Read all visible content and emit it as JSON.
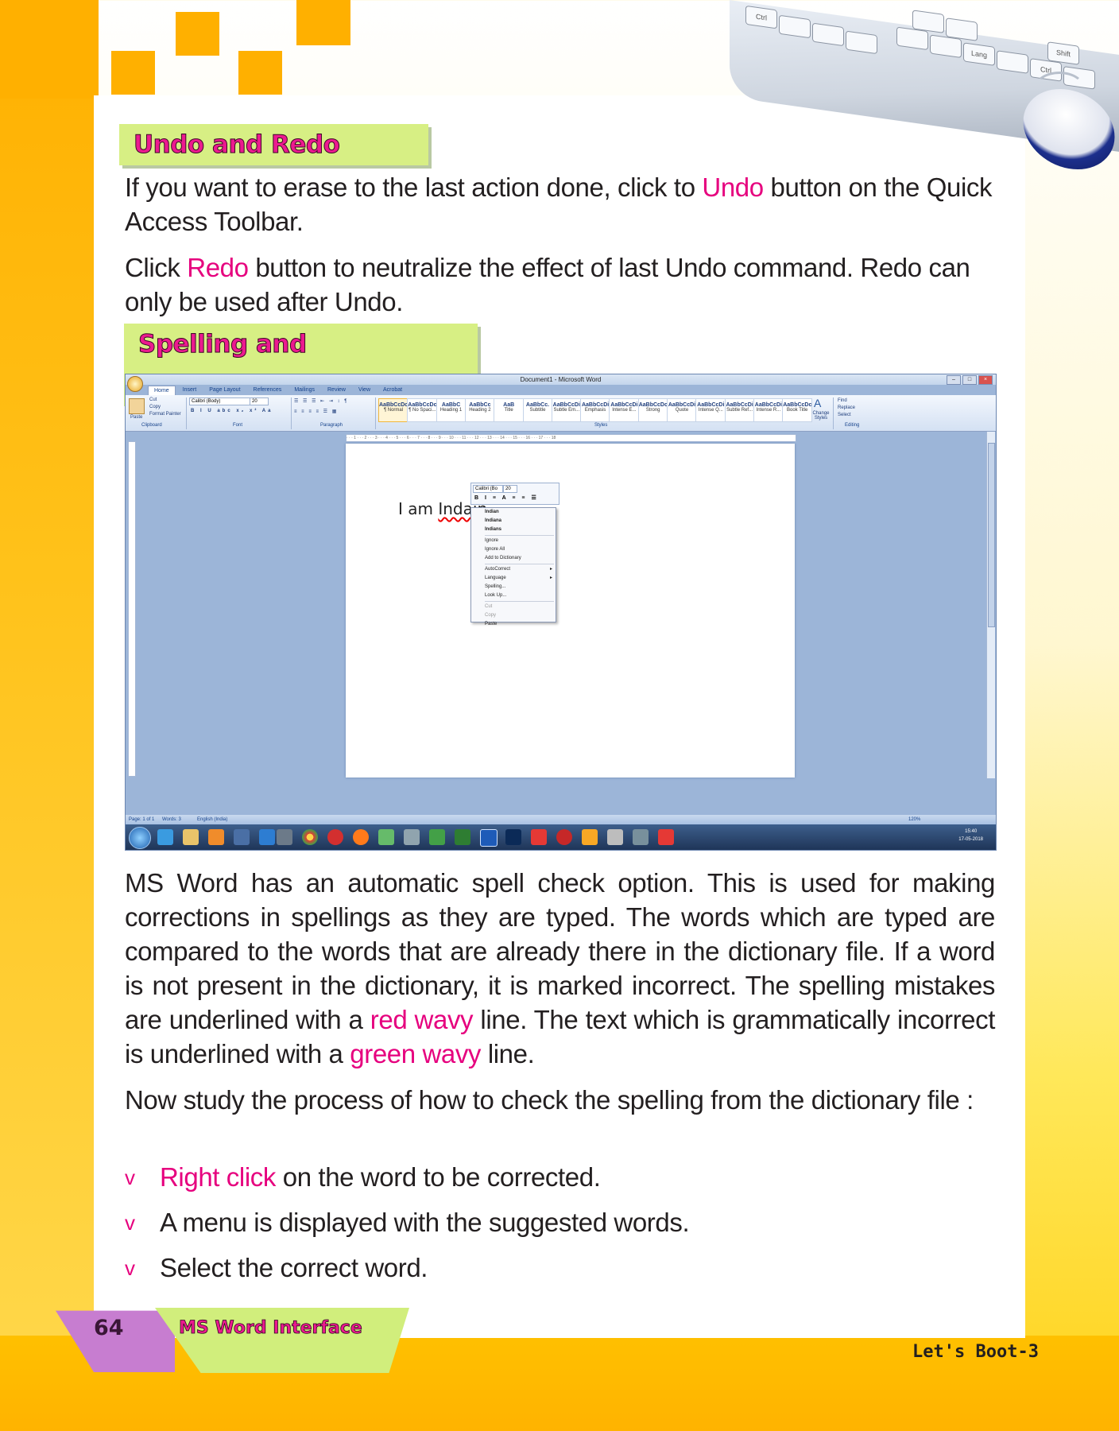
{
  "sections": {
    "undo_redo": {
      "heading": "Undo and Redo",
      "para1_a": "If you want to erase to the last action done, click to ",
      "para1_hl": "Undo",
      "para1_b": " button on the Quick Access Toolbar.",
      "para2_a": "Click ",
      "para2_hl": "Redo",
      "para2_b": " button to neutralize the effect of last Undo command. Redo can only be used after Undo."
    },
    "spelling": {
      "heading": "Spelling and Autocorrect",
      "para1_a": "MS Word has an automatic spell check option. This is used for making corrections in spellings as they are typed. The words which are typed are compared to the words that are already there in the dictionary file. If a word is not present in the dictionary, it is marked incorrect. The spelling mistakes are underlined with a ",
      "para1_hl1": "red wavy",
      "para1_b": " line. The text which is grammatically incorrect is underlined with a ",
      "para1_hl2": "green wavy",
      "para1_c": " line.",
      "para2": "Now study the process of how to check the spelling from the dictionary file :",
      "bullet_marker": "v",
      "bullets": [
        {
          "hl": "Right click",
          "text": " on the word to be corrected."
        },
        {
          "hl": "",
          "text": "A menu is displayed with the suggested words."
        },
        {
          "hl": "",
          "text": "Select the correct word."
        }
      ]
    }
  },
  "screenshot": {
    "title": "Document1 - Microsoft Word",
    "tabs": [
      "Home",
      "Insert",
      "Page Layout",
      "References",
      "Mailings",
      "Review",
      "View",
      "Acrobat"
    ],
    "clipboard": {
      "paste": "Paste",
      "cut": "Cut",
      "copy": "Copy",
      "format_painter": "Format Painter",
      "label": "Clipboard"
    },
    "font": {
      "name": "Calibri (Body)",
      "size": "20",
      "label": "Font"
    },
    "paragraph_label": "Paragraph",
    "styles_label": "Styles",
    "editing_label": "Editing",
    "styles": [
      {
        "preview": "AaBbCcDc",
        "name": "¶ Normal"
      },
      {
        "preview": "AaBbCcDc",
        "name": "¶ No Spaci..."
      },
      {
        "preview": "AaBbC",
        "name": "Heading 1"
      },
      {
        "preview": "AaBbCc",
        "name": "Heading 2"
      },
      {
        "preview": "AaB",
        "name": "Title"
      },
      {
        "preview": "AaBbCc.",
        "name": "Subtitle"
      },
      {
        "preview": "AaBbCcDi",
        "name": "Subtle Em..."
      },
      {
        "preview": "AaBbCcDi",
        "name": "Emphasis"
      },
      {
        "preview": "AaBbCcDi",
        "name": "Intense E..."
      },
      {
        "preview": "AaBbCcDc",
        "name": "Strong"
      },
      {
        "preview": "AaBbCcDi",
        "name": "Quote"
      },
      {
        "preview": "AaBbCcDi",
        "name": "Intense Q..."
      },
      {
        "preview": "AaBbCcDi",
        "name": "Subtle Ref..."
      },
      {
        "preview": "AaBbCcDi",
        "name": "Intense R..."
      },
      {
        "preview": "AaBbCcDc",
        "name": "Book Title"
      }
    ],
    "change_styles": "Change Styles",
    "find": "Find",
    "replace": "Replace",
    "select": "Select",
    "doc_text_a": "I am ",
    "doc_text_err": "Indain",
    "minibar_font": "Calibri (Bo",
    "minibar_size": "20",
    "context_menu": {
      "suggestions": [
        "Indian",
        "Indiana",
        "Indians"
      ],
      "ignore": "Ignore",
      "ignore_all": "Ignore All",
      "add_dict": "Add to Dictionary",
      "autocorrect": "AutoCorrect",
      "language": "Language",
      "spelling": "Spelling...",
      "lookup": "Look Up...",
      "cut": "Cut",
      "copy": "Copy",
      "paste": "Paste"
    },
    "status": {
      "page": "Page: 1 of 1",
      "words": "Words: 3",
      "language": "English (India)",
      "zoom": "120%"
    },
    "clock_time": "15:40",
    "clock_date": "17-05-2018"
  },
  "footer": {
    "page_number": "64",
    "chapter": "MS Word Interface",
    "book": "Let's Boot-3"
  },
  "colors": {
    "accent": "#e6007e",
    "heading_bg": "#d7ef84",
    "page_bg": "#ffd21a"
  }
}
